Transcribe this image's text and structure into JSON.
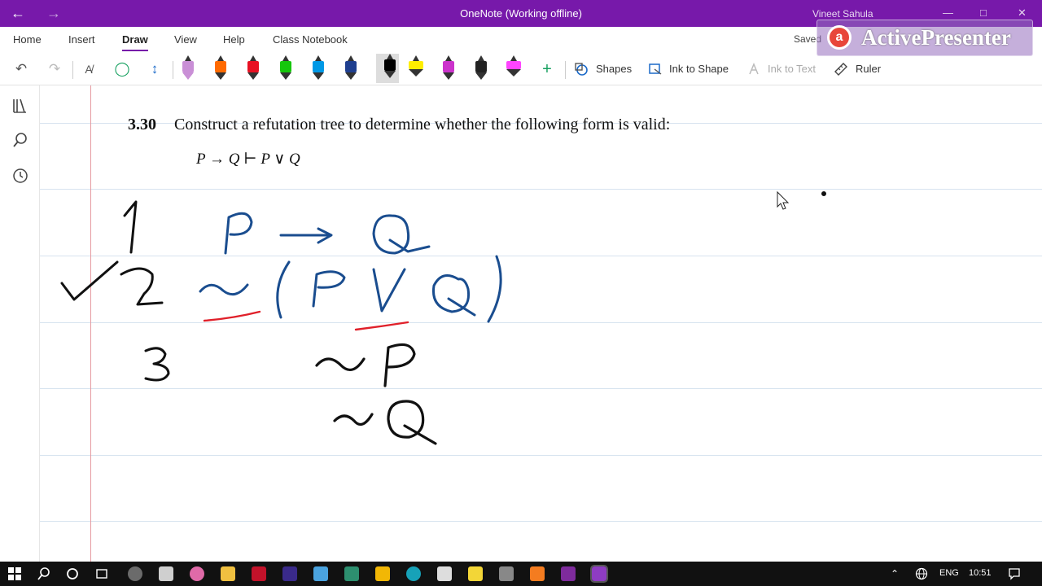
{
  "titlebar": {
    "title": "OneNote (Working offline)",
    "user": "Vineet Sahula",
    "bg_color": "#7719aa"
  },
  "tabs": [
    "Home",
    "Insert",
    "Draw",
    "View",
    "Help",
    "Class Notebook"
  ],
  "active_tab": "Draw",
  "saved_label": "Saved",
  "toolbar": {
    "shapes_label": "Shapes",
    "ink_to_shape_label": "Ink to Shape",
    "ink_to_text_label": "Ink to Text",
    "ruler_label": "Ruler",
    "pens": [
      {
        "name": "pen-pink",
        "color": "#c98fd6",
        "kind": "marker"
      },
      {
        "name": "pen-orange",
        "color": "#ff6a00",
        "kind": "pen"
      },
      {
        "name": "pen-red",
        "color": "#e81123",
        "kind": "pen"
      },
      {
        "name": "pen-green",
        "color": "#16c60c",
        "kind": "pen"
      },
      {
        "name": "pen-cyan",
        "color": "#0099e6",
        "kind": "pen"
      },
      {
        "name": "pen-navy",
        "color": "#1f3f8f",
        "kind": "pen"
      },
      {
        "name": "pen-black",
        "color": "#000000",
        "kind": "pen",
        "selected": true
      },
      {
        "name": "highlighter-yellow",
        "color": "#ffee00",
        "kind": "highlighter"
      },
      {
        "name": "pen-magenta-galaxy",
        "color": "#cc33cc",
        "kind": "pen"
      },
      {
        "name": "pen-black-galaxy",
        "color": "#222222",
        "kind": "pen"
      },
      {
        "name": "highlighter-magenta",
        "color": "#ff44ff",
        "kind": "highlighter"
      }
    ]
  },
  "page": {
    "problem_number": "3.30",
    "problem_text": "Construct a refutation tree to determine whether the following form is valid:",
    "formula": "P → Q ⊢ P ∨ Q"
  },
  "ink": {
    "line1_number": "1",
    "line2_number": "2",
    "line3_number": "3",
    "blue_color": "#1a4d8f",
    "black_color": "#111111",
    "red_color": "#e0202a"
  },
  "watermark": "ActivePresenter",
  "taskbar": {
    "language": "ENG",
    "time": "10:51"
  }
}
